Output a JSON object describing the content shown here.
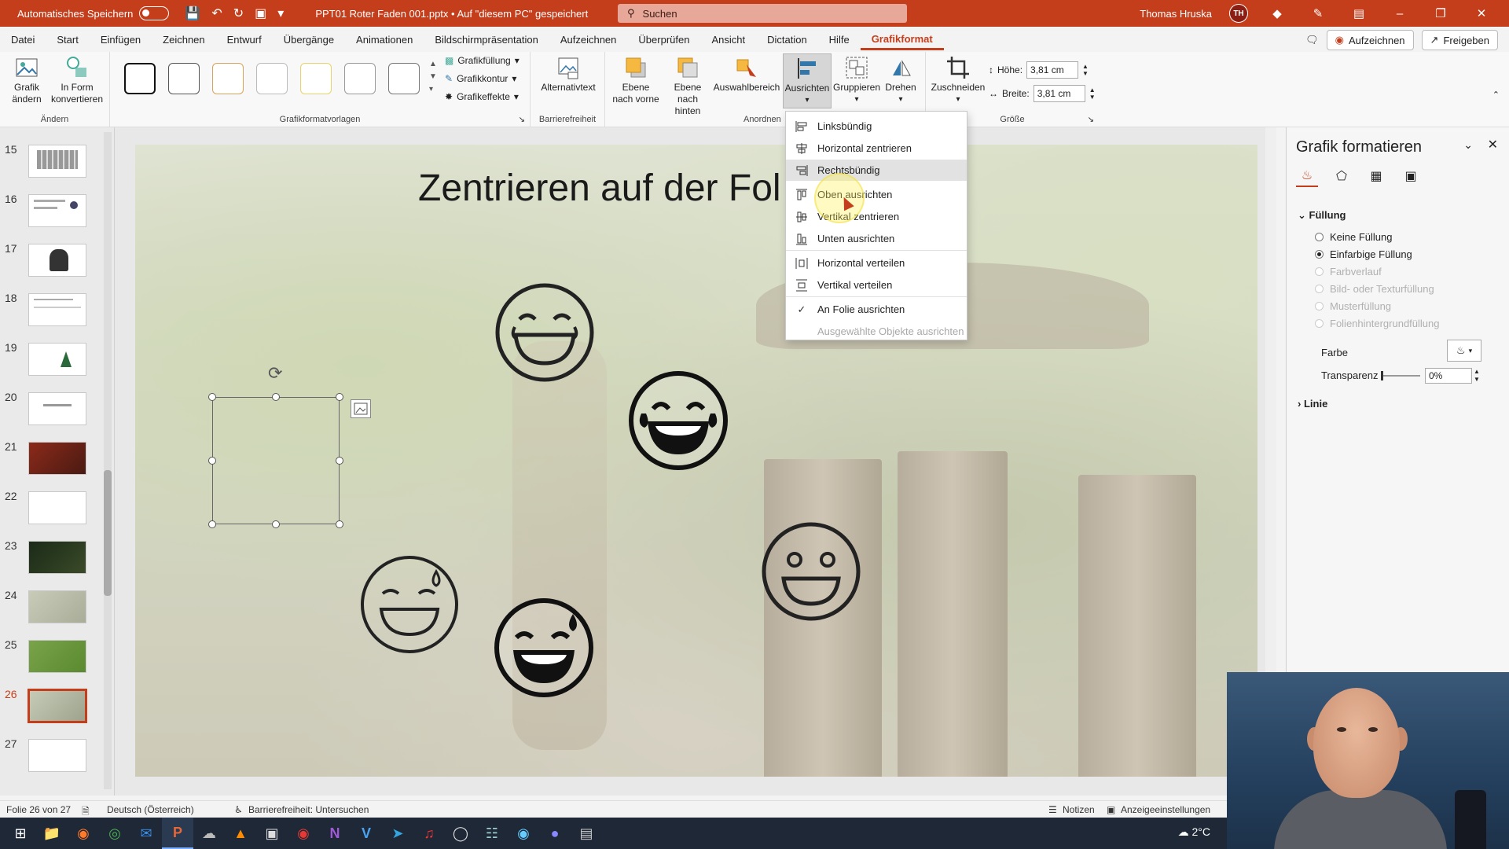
{
  "titlebar": {
    "autosave_label": "Automatisches Speichern",
    "doc_title": "PPT01 Roter Faden 001.pptx • Auf \"diesem PC\" gespeichert",
    "search_placeholder": "Suchen",
    "user_name": "Thomas Hruska",
    "user_initials": "TH"
  },
  "tabs": [
    "Datei",
    "Start",
    "Einfügen",
    "Zeichnen",
    "Entwurf",
    "Übergänge",
    "Animationen",
    "Bildschirmpräsentation",
    "Aufzeichnen",
    "Überprüfen",
    "Ansicht",
    "Dictation",
    "Hilfe",
    "Grafikformat"
  ],
  "tabs_right": {
    "record": "Aufzeichnen",
    "share": "Freigeben"
  },
  "ribbon": {
    "change_graphic": "Grafik ändern",
    "convert_shape": "In Form konvertieren",
    "group_change": "Ändern",
    "fill": "Grafikfüllung",
    "outline": "Grafikkontur",
    "effects": "Grafikeffekte",
    "group_styles": "Grafikformatvorlagen",
    "alt_text": "Alternativtext",
    "group_accessibility": "Barrierefreiheit",
    "bring_forward": "Ebene nach vorne",
    "send_backward": "Ebene nach hinten",
    "selection_pane": "Auswahlbereich",
    "align": "Ausrichten",
    "group": "Gruppieren",
    "rotate": "Drehen",
    "group_arrange": "Anordnen",
    "crop": "Zuschneiden",
    "height_label": "Höhe:",
    "height_value": "3,81 cm",
    "width_label": "Breite:",
    "width_value": "3,81 cm",
    "group_size": "Größe"
  },
  "slides": [
    {
      "num": "15"
    },
    {
      "num": "16"
    },
    {
      "num": "17"
    },
    {
      "num": "18"
    },
    {
      "num": "19"
    },
    {
      "num": "20"
    },
    {
      "num": "21"
    },
    {
      "num": "22"
    },
    {
      "num": "23"
    },
    {
      "num": "24"
    },
    {
      "num": "25"
    },
    {
      "num": "26"
    },
    {
      "num": "27"
    }
  ],
  "slide_title": "Zentrieren auf der Fol",
  "align_menu": {
    "items": [
      {
        "label": "Linksbündig",
        "icon": "align-left-icon"
      },
      {
        "label": "Horizontal zentrieren",
        "icon": "align-center-icon"
      },
      {
        "label": "Rechtsbündig",
        "icon": "align-right-icon"
      },
      {
        "label": "Oben ausrichten",
        "icon": "align-top-icon"
      },
      {
        "label": "Vertikal zentrieren",
        "icon": "align-middle-icon"
      },
      {
        "label": "Unten ausrichten",
        "icon": "align-bottom-icon"
      },
      {
        "label": "Horizontal verteilen",
        "icon": "distribute-horizontal-icon"
      },
      {
        "label": "Vertikal verteilen",
        "icon": "distribute-vertical-icon"
      },
      {
        "label": "An Folie ausrichten",
        "icon": "check-icon"
      },
      {
        "label": "Ausgewählte Objekte ausrichten",
        "icon": ""
      }
    ]
  },
  "format_pane": {
    "title": "Grafik formatieren",
    "fill_section": "Füllung",
    "options": [
      "Keine Füllung",
      "Einfarbige Füllung",
      "Farbverlauf",
      "Bild- oder Texturfüllung",
      "Musterfüllung",
      "Folienhintergrundfüllung"
    ],
    "color_label": "Farbe",
    "transparency_label": "Transparenz",
    "transparency_value": "0%",
    "line_section": "Linie"
  },
  "statusbar": {
    "slide_of": "Folie 26 von 27",
    "language": "Deutsch (Österreich)",
    "accessibility": "Barrierefreiheit: Untersuchen",
    "notes": "Notizen",
    "display_settings": "Anzeigeeinstellungen"
  },
  "taskbar": {
    "weather": "2°C"
  },
  "colors": {
    "accent": "#c43e1c",
    "titlebar": "#c43e1c",
    "taskbar": "#1e2836"
  }
}
